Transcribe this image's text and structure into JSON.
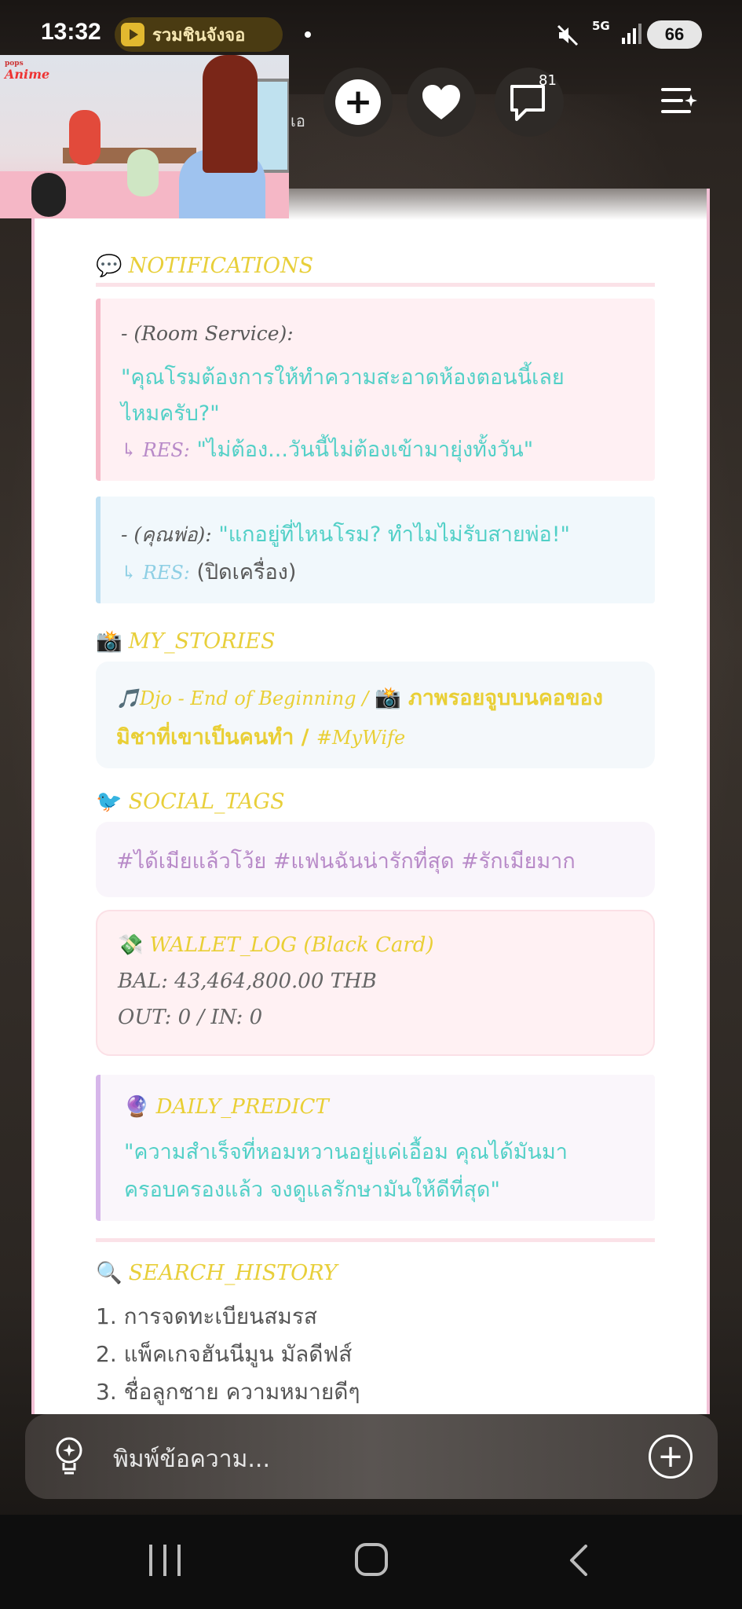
{
  "status": {
    "time": "13:32",
    "live_label": "รวมชินจังจอ",
    "network": "5G",
    "battery": "66"
  },
  "header": {
    "hidden_text": "เอ",
    "chat_badge": "81"
  },
  "pip": {
    "logo_top": "pops",
    "logo": "Anime"
  },
  "notifications": {
    "emoji": "💬",
    "title": "NOTIFICATIONS",
    "items": [
      {
        "sender": "- (Room Service):",
        "message_line1": "\"คุณโรมต้องการให้ทำความสะอาดห้องตอนนี้เลย",
        "message_line2": "ไหมครับ?\"",
        "res_label": "↳ RES:",
        "res_text": "\"ไม่ต้อง...วันนี้ไม่ต้องเข้ามายุ่งทั้งวัน\""
      },
      {
        "sender": "- (คุณพ่อ):",
        "message": "\"แกอยู่ที่ไหนโรม? ทำไมไม่รับสายพ่อ!\"",
        "res_label": "↳ RES:",
        "res_text": "(ปิดเครื่อง)"
      }
    ]
  },
  "stories": {
    "emoji": "📸",
    "title": "MY_STORIES",
    "line1_song": "🎵Djo - End of Beginning / ",
    "line1_photo": "📸 ภาพรอยจูบบนคอของ",
    "line2_text": "มิชาที่เขาเป็นคนทำ / ",
    "line2_tag": "#MyWife"
  },
  "social": {
    "emoji": "🐦",
    "title": "SOCIAL_TAGS",
    "tags": "#ได้เมียแล้วโว้ย #แฟนฉันน่ารักที่สุด #รักเมียมาก"
  },
  "wallet": {
    "emoji": "💸",
    "title": "WALLET_LOG (Black Card)",
    "balance": "BAL: 43,464,800.00 THB",
    "flow": "OUT: 0 / IN: 0"
  },
  "predict": {
    "emoji": "🔮",
    "title": "DAILY_PREDICT",
    "line1": "\"ความสำเร็จที่หอมหวานอยู่แค่เอื้อม คุณได้มันมา",
    "line2": "ครอบครองแล้ว จงดูแลรักษามันให้ดีที่สุด\""
  },
  "search": {
    "emoji": "🔍",
    "title": "SEARCH_HISTORY",
    "items": [
      "1. การจดทะเบียนสมรส",
      "2. แพ็คเกจฮันนีมูน มัลดีฟส์",
      "3. ชื่อลูกชาย ความหมายดีๆ"
    ]
  },
  "input": {
    "placeholder": "พิมพ์ข้อความ..."
  },
  "colors": {
    "title_yellow": "#e8cf3a",
    "aqua": "#52d0c7",
    "lavender": "#b88ac8",
    "card_border": "#f2c1d6"
  }
}
